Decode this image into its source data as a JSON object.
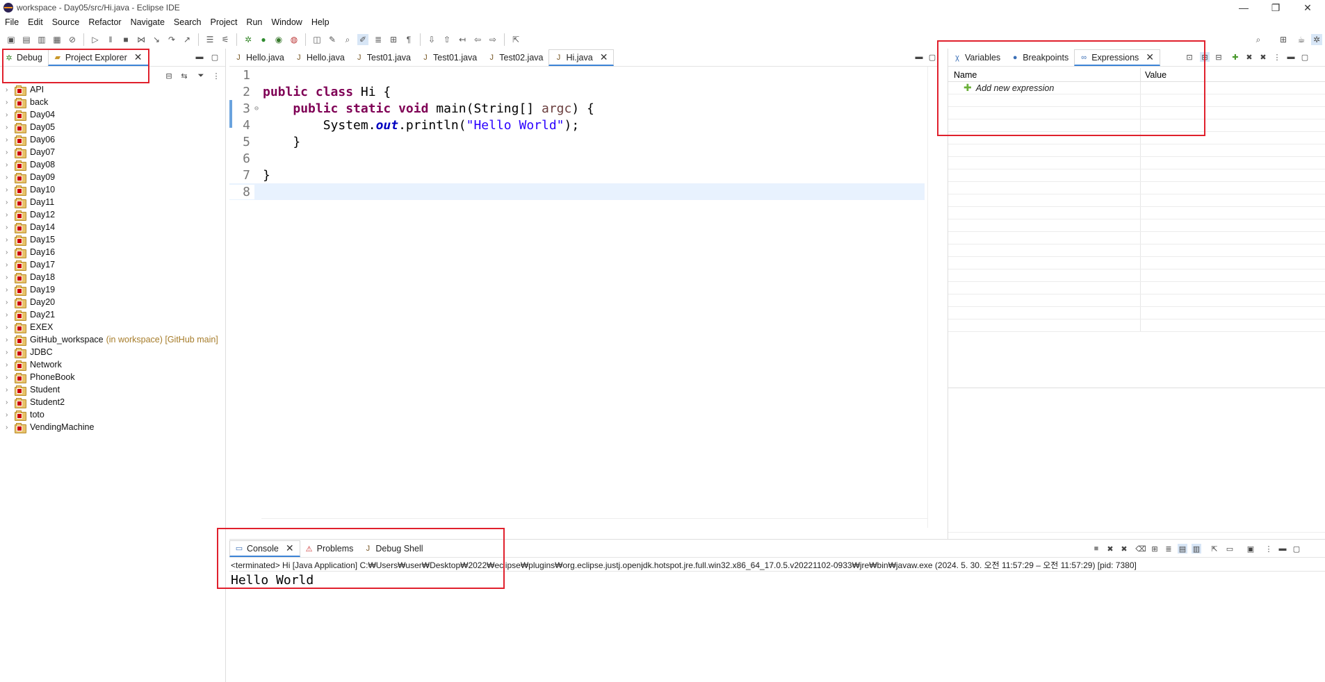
{
  "window": {
    "title": "workspace - Day05/src/Hi.java - Eclipse IDE",
    "minimize": "—",
    "restore": "❐",
    "close": "✕"
  },
  "menu": [
    "File",
    "Edit",
    "Source",
    "Refactor",
    "Navigate",
    "Search",
    "Project",
    "Run",
    "Window",
    "Help"
  ],
  "left_panel": {
    "tabs": [
      {
        "label": "Debug",
        "icon": "bug-icon"
      },
      {
        "label": "Project Explorer",
        "icon": "project-explorer-icon"
      }
    ],
    "projects": [
      {
        "name": "API"
      },
      {
        "name": "back"
      },
      {
        "name": "Day04"
      },
      {
        "name": "Day05"
      },
      {
        "name": "Day06"
      },
      {
        "name": "Day07"
      },
      {
        "name": "Day08"
      },
      {
        "name": "Day09"
      },
      {
        "name": "Day10"
      },
      {
        "name": "Day11"
      },
      {
        "name": "Day12"
      },
      {
        "name": "Day14"
      },
      {
        "name": "Day15"
      },
      {
        "name": "Day16"
      },
      {
        "name": "Day17"
      },
      {
        "name": "Day18"
      },
      {
        "name": "Day19"
      },
      {
        "name": "Day20"
      },
      {
        "name": "Day21"
      },
      {
        "name": "EXEX"
      },
      {
        "name": "GitHub_workspace",
        "decoration": "(in workspace) [GitHub main]"
      },
      {
        "name": "JDBC"
      },
      {
        "name": "Network"
      },
      {
        "name": "PhoneBook"
      },
      {
        "name": "Student"
      },
      {
        "name": "Student2"
      },
      {
        "name": "toto"
      },
      {
        "name": "VendingMachine"
      }
    ]
  },
  "editor": {
    "tabs": [
      "Hello.java",
      "Hello.java",
      "Test01.java",
      "Test01.java",
      "Test02.java",
      "Hi.java"
    ],
    "line_numbers": [
      "1",
      "2",
      "3",
      "4",
      "5",
      "6",
      "7",
      "8"
    ],
    "code": {
      "l2_kw": "public class",
      "l2_rest": " Hi {",
      "l3_kw": "public static void",
      "l3_rest_a": " main(String[] ",
      "l3_var": "argc",
      "l3_rest_b": ") {",
      "l4_a": "System.",
      "l4_field": "out",
      "l4_b": ".println(",
      "l4_str": "\"Hello World\"",
      "l4_c": ");",
      "l5": "}",
      "l7": "}"
    }
  },
  "right_panel": {
    "tabs": [
      {
        "label": "Variables",
        "icon": "variables-icon"
      },
      {
        "label": "Breakpoints",
        "icon": "breakpoints-icon"
      },
      {
        "label": "Expressions",
        "icon": "expressions-icon"
      }
    ],
    "columns": {
      "name": "Name",
      "value": "Value"
    },
    "add_expression": "Add new expression"
  },
  "console": {
    "tabs": [
      {
        "label": "Console",
        "icon": "console-icon"
      },
      {
        "label": "Problems",
        "icon": "problems-icon"
      },
      {
        "label": "Debug Shell",
        "icon": "debug-shell-icon"
      }
    ],
    "status": "<terminated> Hi [Java Application] C:₩Users₩user₩Desktop₩2022₩eclipse₩plugins₩org.eclipse.justj.openjdk.hotspot.jre.full.win32.x86_64_17.0.5.v20221102-0933₩jre₩bin₩javaw.exe  (2024. 5. 30. 오전 11:57:29 – 오전 11:57:29) [pid: 7380]",
    "output": "Hello World"
  },
  "colors": {
    "keyword": "#7f0055",
    "string": "#2a00ff",
    "field": "#0000c0",
    "highlight_box": "#e0202c",
    "current_line": "#e8f2fe"
  }
}
